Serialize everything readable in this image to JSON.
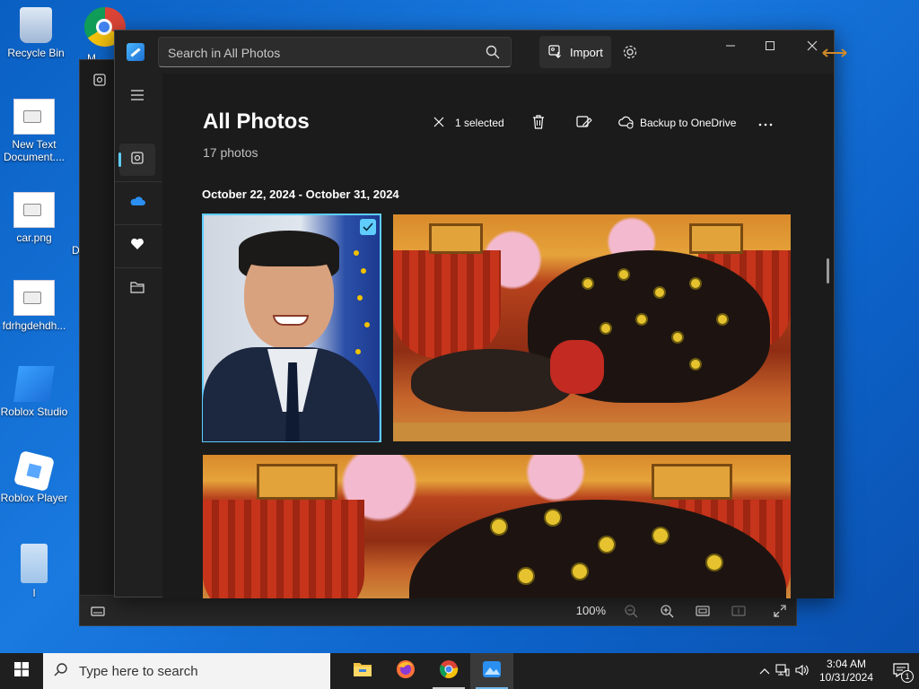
{
  "desktop": {
    "icons": [
      {
        "label": "Recycle Bin",
        "icon": "recycle-bin-icon"
      },
      {
        "label": "New Text Document....",
        "icon": "text-document-icon"
      },
      {
        "label": "car.png",
        "icon": "image-file-icon"
      },
      {
        "label": "fdrhgdehdh...",
        "icon": "image-file-icon"
      },
      {
        "label": "Roblox Studio",
        "icon": "roblox-studio-icon"
      },
      {
        "label": "Roblox Player",
        "icon": "roblox-player-icon"
      },
      {
        "label": "I",
        "icon": "document-icon"
      }
    ],
    "partial_label_right": "D",
    "partial_label_top": "M"
  },
  "photos": {
    "search_placeholder": "Search in All Photos",
    "import_label": "Import",
    "page_title": "All Photos",
    "photo_count": "17 photos",
    "selected_label": "1 selected",
    "backup_label": "Backup to OneDrive",
    "date_range": "October 22, 2024 - October 31, 2024",
    "nav": [
      "menu-icon",
      "gallery-icon",
      "onedrive-icon",
      "favorites-icon",
      "folders-icon"
    ],
    "zoom_level": "100%",
    "accent": "#60cdff"
  },
  "taskbar": {
    "search_placeholder": "Type here to search",
    "apps": [
      "file-explorer-icon",
      "firefox-icon",
      "chrome-icon",
      "photos-icon"
    ],
    "time": "3:04 AM",
    "date": "10/31/2024",
    "notification_count": "1"
  }
}
